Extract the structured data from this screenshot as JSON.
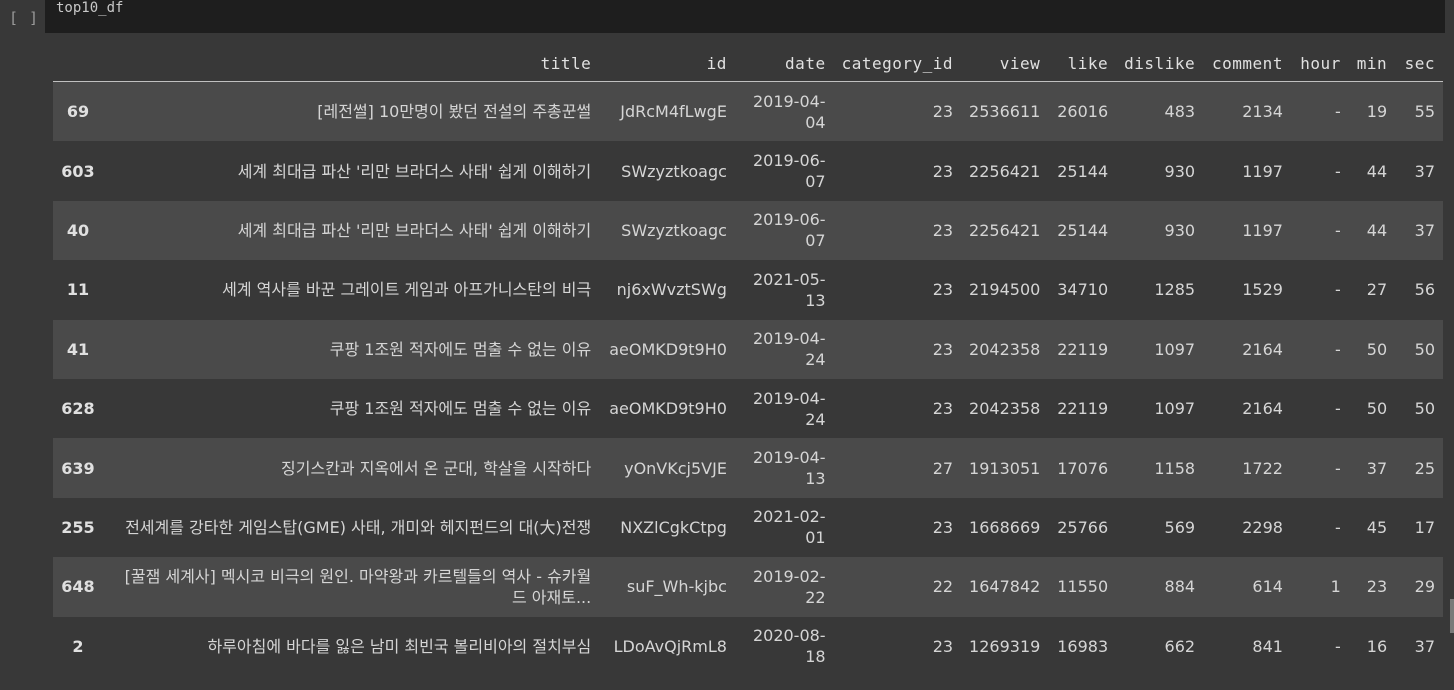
{
  "cell": {
    "prompt": "[ ]",
    "code": "top10_df"
  },
  "dataframe": {
    "columns": [
      "",
      "title",
      "id",
      "date",
      "category_id",
      "view",
      "like",
      "dislike",
      "comment",
      "hour",
      "min",
      "sec"
    ],
    "rows": [
      {
        "index": "69",
        "title": "[레전썰] 10만명이 봤던 전설의 주총꾼썰",
        "id": "JdRcM4fLwgE",
        "date": "2019-04-04",
        "category_id": "23",
        "view": "2536611",
        "like": "26016",
        "dislike": "483",
        "comment": "2134",
        "hour": "-",
        "min": "19",
        "sec": "55"
      },
      {
        "index": "603",
        "title": "세계 최대급 파산 '리만 브라더스 사태' 쉽게 이해하기",
        "id": "SWzyztkoagc",
        "date": "2019-06-07",
        "category_id": "23",
        "view": "2256421",
        "like": "25144",
        "dislike": "930",
        "comment": "1197",
        "hour": "-",
        "min": "44",
        "sec": "37"
      },
      {
        "index": "40",
        "title": "세계 최대급 파산 '리만 브라더스 사태' 쉽게 이해하기",
        "id": "SWzyztkoagc",
        "date": "2019-06-07",
        "category_id": "23",
        "view": "2256421",
        "like": "25144",
        "dislike": "930",
        "comment": "1197",
        "hour": "-",
        "min": "44",
        "sec": "37"
      },
      {
        "index": "11",
        "title": "세계 역사를 바꾼 그레이트 게임과 아프가니스탄의 비극",
        "id": "nj6xWvztSWg",
        "date": "2021-05-13",
        "category_id": "23",
        "view": "2194500",
        "like": "34710",
        "dislike": "1285",
        "comment": "1529",
        "hour": "-",
        "min": "27",
        "sec": "56"
      },
      {
        "index": "41",
        "title": "쿠팡 1조원 적자에도 멈출 수 없는 이유",
        "id": "aeOMKD9t9H0",
        "date": "2019-04-24",
        "category_id": "23",
        "view": "2042358",
        "like": "22119",
        "dislike": "1097",
        "comment": "2164",
        "hour": "-",
        "min": "50",
        "sec": "50"
      },
      {
        "index": "628",
        "title": "쿠팡 1조원 적자에도 멈출 수 없는 이유",
        "id": "aeOMKD9t9H0",
        "date": "2019-04-24",
        "category_id": "23",
        "view": "2042358",
        "like": "22119",
        "dislike": "1097",
        "comment": "2164",
        "hour": "-",
        "min": "50",
        "sec": "50"
      },
      {
        "index": "639",
        "title": "징기스칸과 지옥에서 온 군대, 학살을 시작하다",
        "id": "yOnVKcj5VJE",
        "date": "2019-04-13",
        "category_id": "27",
        "view": "1913051",
        "like": "17076",
        "dislike": "1158",
        "comment": "1722",
        "hour": "-",
        "min": "37",
        "sec": "25"
      },
      {
        "index": "255",
        "title": "전세계를 강타한 게임스탑(GME) 사태, 개미와 헤지펀드의 대(大)전쟁",
        "id": "NXZlCgkCtpg",
        "date": "2021-02-01",
        "category_id": "23",
        "view": "1668669",
        "like": "25766",
        "dislike": "569",
        "comment": "2298",
        "hour": "-",
        "min": "45",
        "sec": "17"
      },
      {
        "index": "648",
        "title": "[꿀잼 세계사] 멕시코 비극의 원인. 마약왕과 카르텔들의 역사 - 슈카월드 아재토...",
        "id": "suF_Wh-kjbc",
        "date": "2019-02-22",
        "category_id": "22",
        "view": "1647842",
        "like": "11550",
        "dislike": "884",
        "comment": "614",
        "hour": "1",
        "min": "23",
        "sec": "29"
      },
      {
        "index": "2",
        "title": "하루아침에 바다를 잃은 남미 최빈국 볼리비아의 절치부심",
        "id": "LDoAvQjRmL8",
        "date": "2020-08-18",
        "category_id": "23",
        "view": "1269319",
        "like": "16983",
        "dislike": "662",
        "comment": "841",
        "hour": "-",
        "min": "16",
        "sec": "37"
      }
    ]
  }
}
